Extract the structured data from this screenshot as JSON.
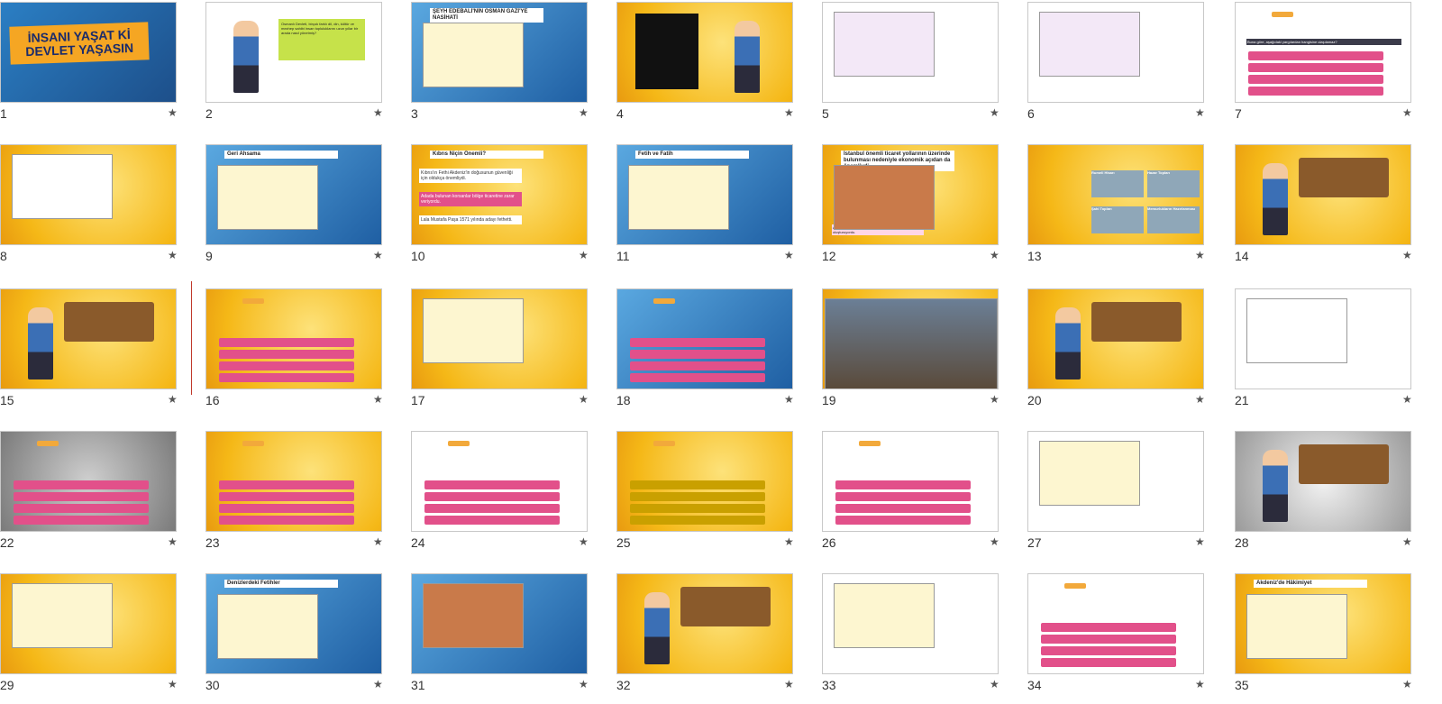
{
  "slides": [
    {
      "n": "1",
      "title": "İNSANI YAŞAT Kİ DEVLET YAŞASIN",
      "bg": "#f7c531",
      "kind": "title"
    },
    {
      "n": "2",
      "bg": "#ffffff",
      "kind": "speech",
      "text": "Osmanlı Devleti, birçok farklı dil, din, kültür ve mezhep sahibi insan topluluklarını uzun yıllar bir arada nasıl yönetmiş?"
    },
    {
      "n": "3",
      "bg": "#2a8fd0",
      "kind": "panel",
      "heading": "ŞEYH EDEBALİ'NİN OSMAN GAZİ'YE NASİHATİ"
    },
    {
      "n": "4",
      "bg": "#f7c531",
      "kind": "quote"
    },
    {
      "n": "5",
      "bg": "#ffffff",
      "kind": "card"
    },
    {
      "n": "6",
      "bg": "#ffffff",
      "kind": "card"
    },
    {
      "n": "7",
      "bg": "#ffffff",
      "kind": "quiz",
      "q": "Buna göre, aşağıdaki yargılardan hangisine ulaşılamaz?"
    },
    {
      "n": "8",
      "bg": "#f7c531",
      "kind": "table"
    },
    {
      "n": "9",
      "bg": "#2a6fb0",
      "kind": "panel",
      "heading": "Geri Ahsama"
    },
    {
      "n": "10",
      "bg": "#f7c531",
      "kind": "text",
      "heading": "Kıbrıs Niçin Önemli?",
      "lines": [
        "Kıbrıs'ın Fethi Akdeniz'in doğusunun güvenliği için oldukça önemliydi.",
        "Adada bulunan korsanlar bölge ticaretine zarar veriyordu.",
        "Lala Mustafa Paşa 1571 yılında adayı fethetti."
      ]
    },
    {
      "n": "11",
      "bg": "#2a6fb0",
      "kind": "text",
      "heading": "Fetih ve Fatih"
    },
    {
      "n": "12",
      "bg": "#f7c531",
      "kind": "map",
      "heading": "İstanbul önemli ticaret yollarının üzerinde bulunması nedeniyle ekonomik açıdan da önemliydi.",
      "caption": "Ayrıca Bizans, başkent Osmanlı için tehdit oluşturuyordu."
    },
    {
      "n": "13",
      "bg": "#f7c531",
      "kind": "photos",
      "labels": [
        "Rumeli Hisarı",
        "Hazar Topları",
        "Şahi Topları",
        "Memurlukların Hazırlanması"
      ]
    },
    {
      "n": "14",
      "bg": "#f7c531",
      "kind": "speech"
    },
    {
      "n": "15",
      "bg": "#f7c531",
      "kind": "speech"
    },
    {
      "n": "16",
      "bg": "#f7c531",
      "kind": "quiz"
    },
    {
      "n": "17",
      "bg": "#f7c531",
      "kind": "list"
    },
    {
      "n": "18",
      "bg": "#2a6fb0",
      "kind": "quiz"
    },
    {
      "n": "19",
      "bg": "#f7c531",
      "kind": "photo"
    },
    {
      "n": "20",
      "bg": "#f7c531",
      "kind": "speech"
    },
    {
      "n": "21",
      "bg": "#ffffff",
      "kind": "table"
    },
    {
      "n": "22",
      "bg": "#888888",
      "kind": "quiz"
    },
    {
      "n": "23",
      "bg": "#f7c531",
      "kind": "quiz"
    },
    {
      "n": "24",
      "bg": "#ffffff",
      "kind": "quiz"
    },
    {
      "n": "25",
      "bg": "#f7c531",
      "kind": "quiz"
    },
    {
      "n": "26",
      "bg": "#ffffff",
      "kind": "quiz"
    },
    {
      "n": "27",
      "bg": "#ffffff",
      "kind": "panel"
    },
    {
      "n": "28",
      "bg": "#bbbbbb",
      "kind": "speech"
    },
    {
      "n": "29",
      "bg": "#f7c531",
      "kind": "panel"
    },
    {
      "n": "30",
      "bg": "#2a8fd0",
      "kind": "panel",
      "heading": "Denizlerdeki Fetihler"
    },
    {
      "n": "31",
      "bg": "#2a8fd0",
      "kind": "map"
    },
    {
      "n": "32",
      "bg": "#f7c531",
      "kind": "speech"
    },
    {
      "n": "33",
      "bg": "#ffffff",
      "kind": "list"
    },
    {
      "n": "34",
      "bg": "#ffffff",
      "kind": "quiz"
    },
    {
      "n": "35",
      "bg": "#f7c531",
      "kind": "panel",
      "heading": "Akdeniz'de Hâkimiyet"
    }
  ],
  "star": "★"
}
